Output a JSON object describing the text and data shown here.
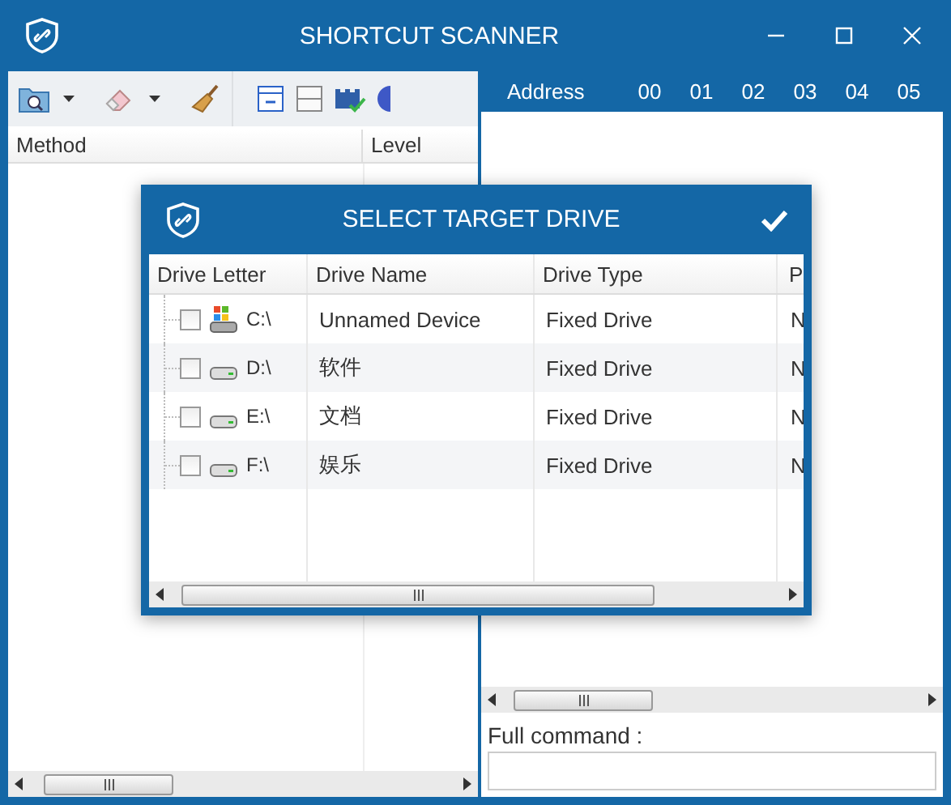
{
  "window": {
    "title": "SHORTCUT SCANNER"
  },
  "method_table": {
    "columns": [
      "Method",
      "Level"
    ]
  },
  "hex_view": {
    "columns": [
      "Address",
      "00",
      "01",
      "02",
      "03",
      "04",
      "05"
    ]
  },
  "full_command": {
    "label": "Full command :"
  },
  "dialog": {
    "title": "SELECT TARGET DRIVE",
    "columns": [
      "Drive Letter",
      "Drive Name",
      "Drive Type",
      "P"
    ],
    "rows": [
      {
        "kind": "system",
        "checked": false,
        "letter": "C:\\",
        "name": "Unnamed Device",
        "type": "Fixed Drive",
        "column_4": "N"
      },
      {
        "kind": "disk",
        "checked": false,
        "letter": "D:\\",
        "name": "软件",
        "type": "Fixed Drive",
        "column_4": "N"
      },
      {
        "kind": "disk",
        "checked": false,
        "letter": "E:\\",
        "name": "文档",
        "type": "Fixed Drive",
        "column_4": "N"
      },
      {
        "kind": "disk",
        "checked": false,
        "letter": "F:\\",
        "name": "娱乐",
        "type": "Fixed Drive",
        "column_4": "N"
      }
    ]
  }
}
